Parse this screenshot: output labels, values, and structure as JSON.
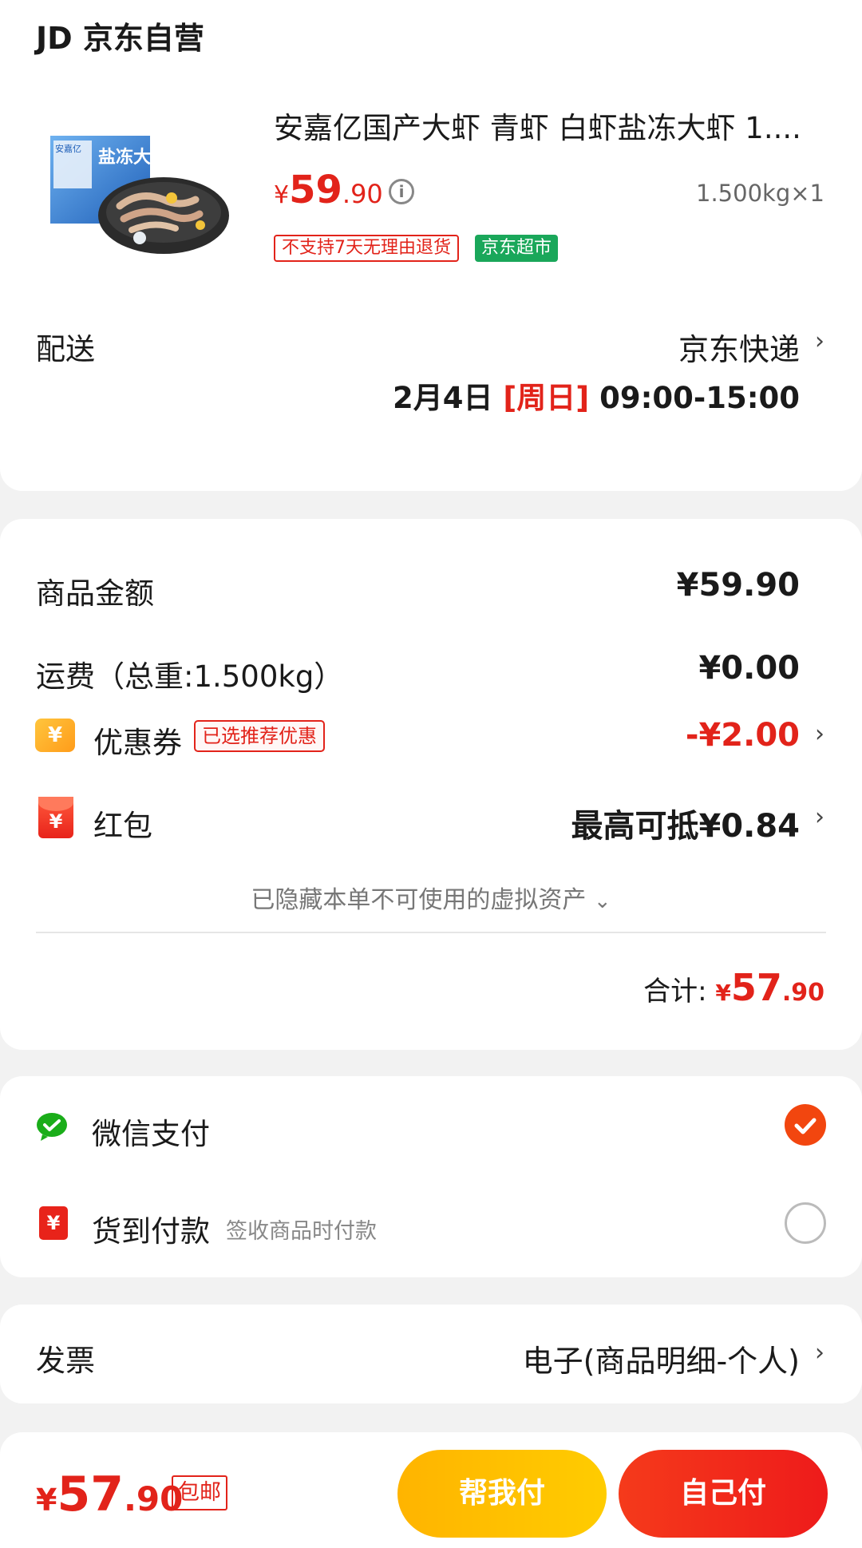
{
  "shop": {
    "name": "JD 京东自营"
  },
  "product": {
    "title": "安嘉亿国产大虾 青虾 白虾盐冻大虾 1....",
    "image_text": "盐冻大虾",
    "image_brand": "安嘉亿",
    "price_currency": "¥",
    "price_int": "59",
    "price_dec": ".90",
    "qty": "1.500kg×1",
    "badge_return": "不支持7天无理由退货",
    "badge_supermarket": "京东超市"
  },
  "delivery": {
    "label": "配送",
    "method": "京东快递",
    "date": "2月4日 ",
    "weekday": "[周日]",
    "time": " 09:00-15:00"
  },
  "price_summary": {
    "goods_label": "商品金额",
    "goods_value": "¥59.90",
    "shipping_label": "运费（总重:1.500kg）",
    "shipping_value": "¥0.00",
    "coupon_icon": "¥",
    "coupon_label": "优惠券",
    "coupon_badge": "已选推荐优惠",
    "coupon_value": "-¥2.00",
    "hongbao_icon": "¥",
    "hongbao_label": "红包",
    "hongbao_value": "最高可抵¥0.84",
    "hidden_assets": "已隐藏本单不可使用的虚拟资产",
    "total_label": "合计: ",
    "total_currency": "¥",
    "total_int": "57",
    "total_dec": ".90"
  },
  "payment": {
    "wechat_label": "微信支付",
    "cod_icon": "¥",
    "cod_label": "货到付款",
    "cod_desc": "签收商品时付款"
  },
  "invoice": {
    "label": "发票",
    "value": "电子(商品明细-个人)"
  },
  "bottom": {
    "currency": "¥",
    "price_int": "57",
    "price_dec": ".90",
    "free_shipping": "包邮",
    "help_pay": "帮我付",
    "self_pay": "自己付"
  },
  "colors": {
    "accent_red": "#e2231a",
    "wechat_green": "#1aad19",
    "supermarket_green": "#1aa75a",
    "help_pay_yellow": "#ffb400"
  }
}
